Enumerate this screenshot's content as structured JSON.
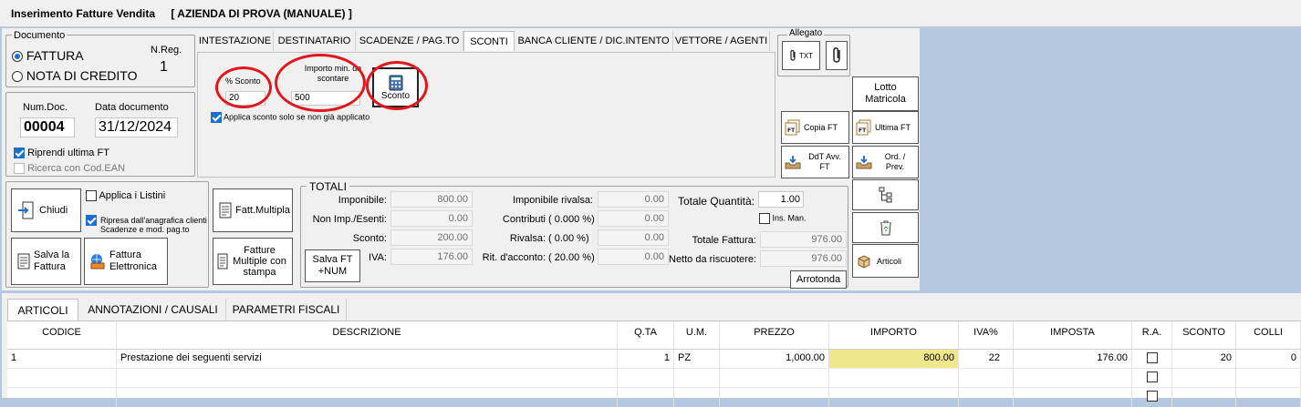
{
  "window": {
    "title": "Inserimento Fatture Vendita",
    "company": "[ AZIENDA DI PROVA (MANUALE) ]"
  },
  "documento": {
    "group_label": "Documento",
    "fattura_label": "FATTURA",
    "nota_credito_label": "NOTA DI CREDITO",
    "selected": "FATTURA",
    "nreg_label": "N.Reg.",
    "nreg_value": "1"
  },
  "numdoc": {
    "num_label": "Num.Doc.",
    "num_value": "00004",
    "date_label": "Data documento",
    "date_value": "31/12/2024",
    "riprendi_label": "Riprendi ultima FT",
    "riprendi_checked": true,
    "ricerca_label": "Ricerca con Cod.EAN",
    "ricerca_checked": false
  },
  "tabs": [
    "INTESTAZIONE",
    "DESTINATARIO",
    "SCADENZE / PAG.TO",
    "SCONTI",
    "BANCA CLIENTE  / DIC.INTENTO",
    "VETTORE / AGENTI"
  ],
  "active_tab": "SCONTI",
  "sconti": {
    "percent_label": "% Sconto",
    "percent_value": "20",
    "importo_label": "Importo min. da scontare",
    "importo_value": "500",
    "sconto_button": "Sconto",
    "applica_label": "Applica sconto solo se non già applicato",
    "applica_checked": true
  },
  "allegato": {
    "label": "Allegato",
    "txt_button": "TXT"
  },
  "side_buttons": {
    "lotto": "Lotto Matricola",
    "copia": "Copia FT",
    "ultima": "Ultima FT",
    "ddt": "DdT Avv. FT",
    "ord": "Ord. / Prev.",
    "articoli": "Articoli"
  },
  "actions": {
    "chiudi": "Chiudi",
    "applica_listini": "Applica i Listini",
    "applica_listini_checked": false,
    "ripresa": "Ripresa dall'anagrafica clienti Scadenze e mod. pag.to",
    "ripresa_checked": true,
    "fatt_multipla": "Fatt.Multipla",
    "salva": "Salva la Fattura",
    "elettronica": "Fattura Elettronica",
    "multiple_stampa": "Fatture Multiple con stampa",
    "salva_num": "Salva FT +NUM"
  },
  "totali": {
    "label": "TOTALI",
    "imponibile_label": "Imponibile:",
    "imponibile": "800.00",
    "nonimp_label": "Non Imp./Esenti:",
    "nonimp": "0.00",
    "sconto_label": "Sconto:",
    "sconto": "200.00",
    "iva_label": "IVA:",
    "iva": "176.00",
    "imp_rivalsa_label": "Imponibile rivalsa:",
    "imp_rivalsa": "0.00",
    "contributi_label": "Contributi",
    "contributi_pct": "( 0.000 %)",
    "contributi": "0.00",
    "rivalsa_label": "Rivalsa:",
    "rivalsa_pct": "(  0.00 %)",
    "rivalsa": "0.00",
    "ritacconto_label": "Rit. d'acconto:",
    "ritacconto_pct": "( 20.00 %)",
    "ritacconto": "0.00",
    "tot_qta_label": "Totale Quantità:",
    "tot_qta": "1.00",
    "ins_man_label": "Ins. Man.",
    "tot_fattura_label": "Totale Fattura:",
    "tot_fattura": "976.00",
    "netto_label": "Netto da riscuotere:",
    "netto": "976.00",
    "arrotonda": "Arrotonda"
  },
  "bottom_tabs": [
    "ARTICOLI",
    "ANNOTAZIONI  / CAUSALI",
    "PARAMETRI FISCALI"
  ],
  "grid": {
    "headers": [
      "CODICE",
      "DESCRIZIONE",
      "Q.TA",
      "U.M.",
      "PREZZO",
      "IMPORTO",
      "IVA%",
      "IMPOSTA",
      "R.A.",
      "SCONTO",
      "COLLI"
    ],
    "rows": [
      {
        "codice": "1",
        "descrizione": "Prestazione dei seguenti servizi",
        "qta": "1",
        "um": "PZ",
        "prezzo": "1,000.00",
        "importo": "800.00",
        "iva": "22",
        "imposta": "176.00",
        "sconto": "20",
        "colli": "0"
      }
    ]
  },
  "colors": {
    "accent": "#1a6fd0",
    "highlight": "#f0e68c",
    "annotation": "#e0181e",
    "background": "#b4c8e0"
  }
}
